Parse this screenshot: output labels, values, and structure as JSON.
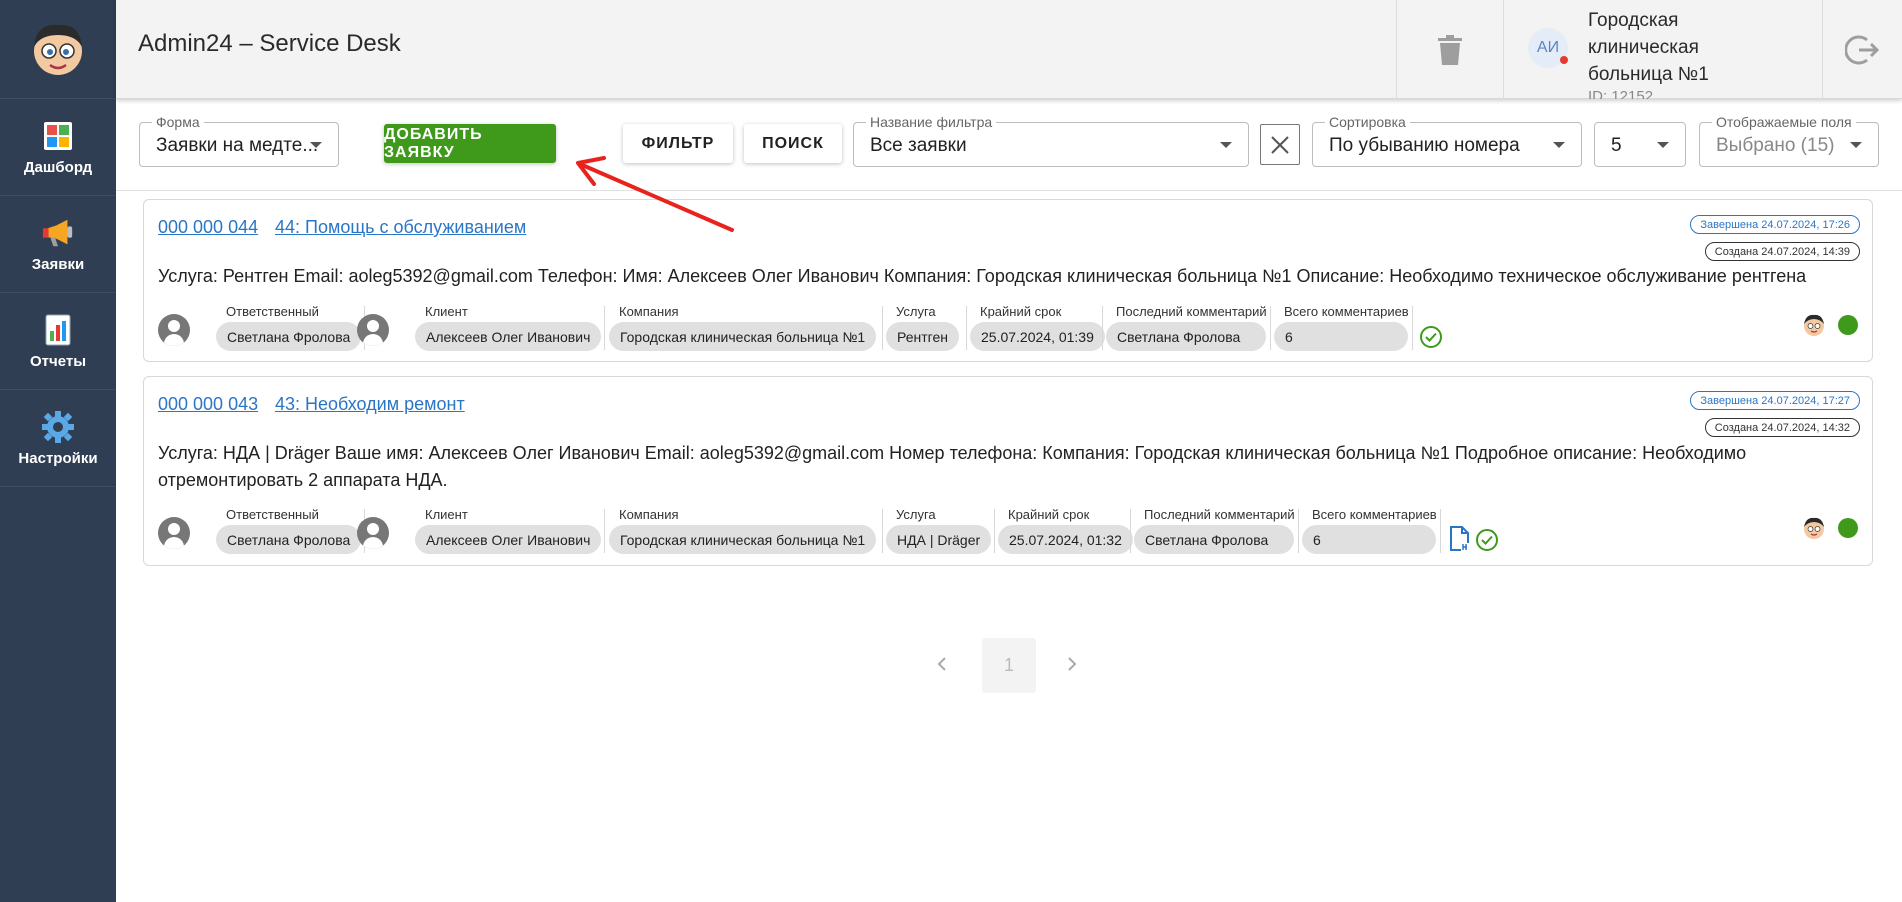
{
  "sidebar": {
    "items": [
      {
        "label": "Дашборд",
        "icon": "dashboard-icon"
      },
      {
        "label": "Заявки",
        "icon": "megaphone-icon"
      },
      {
        "label": "Отчеты",
        "icon": "report-icon"
      },
      {
        "label": "Настройки",
        "icon": "gear-icon"
      }
    ]
  },
  "header": {
    "title": "Admin24 – Service Desk",
    "user_initials": "АИ",
    "org_name": "Городская клиническая больница №1",
    "org_id": "ID: 12152"
  },
  "toolbar": {
    "form_label": "Форма",
    "form_value": "Заявки на медте...",
    "add_button": "ДОБАВИТЬ ЗАЯВКУ",
    "filter_button": "ФИЛЬТР",
    "search_button": "ПОИСК",
    "filter_name_label": "Название фильтра",
    "filter_name_value": "Все заявки",
    "sort_label": "Сортировка",
    "sort_value": "По убыванию номера",
    "page_size": "5",
    "fields_label": "Отображаемые поля",
    "fields_value": "Выбрано (15)"
  },
  "columns": {
    "responsible": "Ответственный",
    "client": "Клиент",
    "company": "Компания",
    "service": "Услуга",
    "deadline": "Крайний срок",
    "last_comment": "Последний комментарий",
    "total_comments": "Всего комментариев"
  },
  "tickets": [
    {
      "number": "000 000 044",
      "title": "44: Помощь с обслуживанием",
      "completed": "Завершена 24.07.2024, 17:26",
      "created": "Создана 24.07.2024, 14:39",
      "description": "Услуга: Рентген Email: aoleg5392@gmail.com Телефон: Имя: Алексеев Олег Иванович Компания: Городская клиническая больница №1 Описание: Необходимо техническое обслуживание рентгена",
      "responsible": "Светлана Фролова",
      "client": "Алексеев Олег Иванович",
      "company": "Городская клиническая больница №1",
      "service": "Рентген",
      "deadline": "25.07.2024, 01:39",
      "last_comment": "Светлана Фролова",
      "total_comments": "6"
    },
    {
      "number": "000 000 043",
      "title": "43: Необходим ремонт",
      "completed": "Завершена 24.07.2024, 17:27",
      "created": "Создана 24.07.2024, 14:32",
      "description": "Услуга: НДА | Dräger Ваше имя: Алексеев Олег Иванович Email: aoleg5392@gmail.com Номер телефона: Компания: Городская клиническая больница №1 Подробное описание: Необходимо отремонтировать 2 аппарата НДА.",
      "responsible": "Светлана Фролова",
      "client": "Алексеев Олег Иванович",
      "company": "Городская клиническая больница №1",
      "service": "НДА | Dräger",
      "deadline": "25.07.2024, 01:32",
      "last_comment": "Светлана Фролова",
      "total_comments": "6"
    }
  ],
  "pagination": {
    "current": "1"
  },
  "colors": {
    "accent_green": "#3f9a1b",
    "sidebar": "#2f3e52",
    "link_blue": "#2a76c6"
  }
}
